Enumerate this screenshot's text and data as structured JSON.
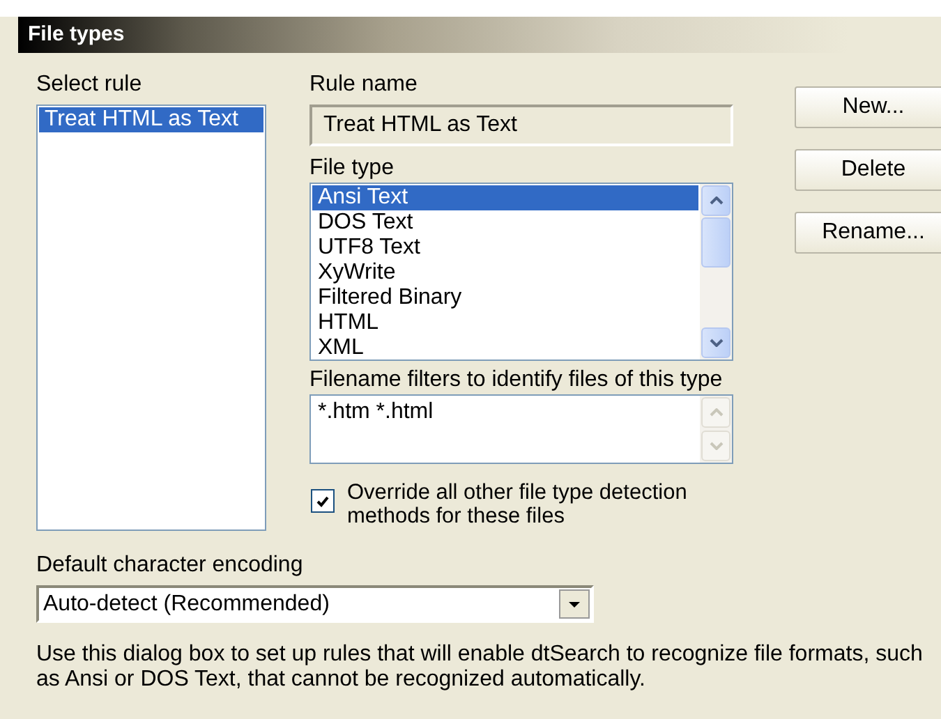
{
  "title": "File types",
  "select_rule": {
    "label": "Select rule",
    "items": [
      {
        "label": "Treat HTML as Text",
        "selected": true
      }
    ]
  },
  "rule_name": {
    "label": "Rule name",
    "value": "Treat HTML as Text"
  },
  "file_type": {
    "label": "File type",
    "items": [
      {
        "label": "Ansi Text",
        "selected": true
      },
      {
        "label": "DOS Text",
        "selected": false
      },
      {
        "label": "UTF8 Text",
        "selected": false
      },
      {
        "label": "XyWrite",
        "selected": false
      },
      {
        "label": "Filtered Binary",
        "selected": false
      },
      {
        "label": "HTML",
        "selected": false
      },
      {
        "label": "XML",
        "selected": false
      }
    ]
  },
  "filename_filters": {
    "label": "Filename filters to identify files of this type",
    "value": "*.htm *.html"
  },
  "override": {
    "label": "Override all other file type detection methods for these files",
    "checked": true
  },
  "buttons": [
    "New...",
    "Delete",
    "Rename..."
  ],
  "encoding": {
    "label": "Default character encoding",
    "value": "Auto-detect (Recommended)"
  },
  "help_text": "Use this dialog box to set up rules that will enable dtSearch to recognize file formats, such as Ansi or DOS Text, that cannot be recognized automatically."
}
